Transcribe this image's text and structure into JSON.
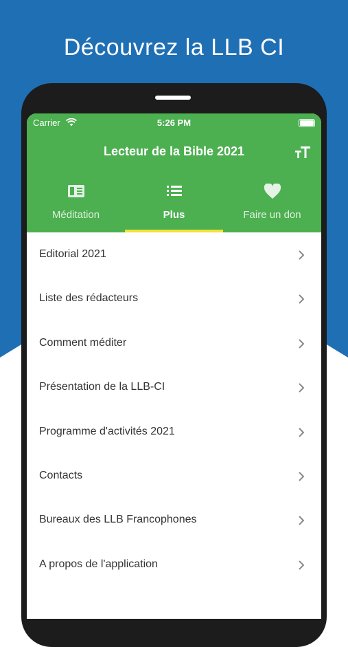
{
  "headline": "Découvrez la LLB CI",
  "status_bar": {
    "carrier": "Carrier",
    "time": "5:26 PM"
  },
  "app": {
    "title": "Lecteur de la Bible 2021"
  },
  "tabs": [
    {
      "label": "Méditation",
      "icon": "book-icon"
    },
    {
      "label": "Plus",
      "icon": "list-icon",
      "active": true
    },
    {
      "label": "Faire un don",
      "icon": "heart-icon"
    }
  ],
  "menu": [
    {
      "label": "Editorial 2021"
    },
    {
      "label": "Liste des rédacteurs"
    },
    {
      "label": "Comment méditer"
    },
    {
      "label": "Présentation de la LLB-CI"
    },
    {
      "label": "Programme d'activités 2021"
    },
    {
      "label": "Contacts"
    },
    {
      "label": "Bureaux des LLB Francophones"
    },
    {
      "label": "A propos de l'application"
    }
  ],
  "colors": {
    "brand_green": "#4caf50",
    "background_blue": "#1f6fb5",
    "tab_indicator": "#f4e23a"
  }
}
